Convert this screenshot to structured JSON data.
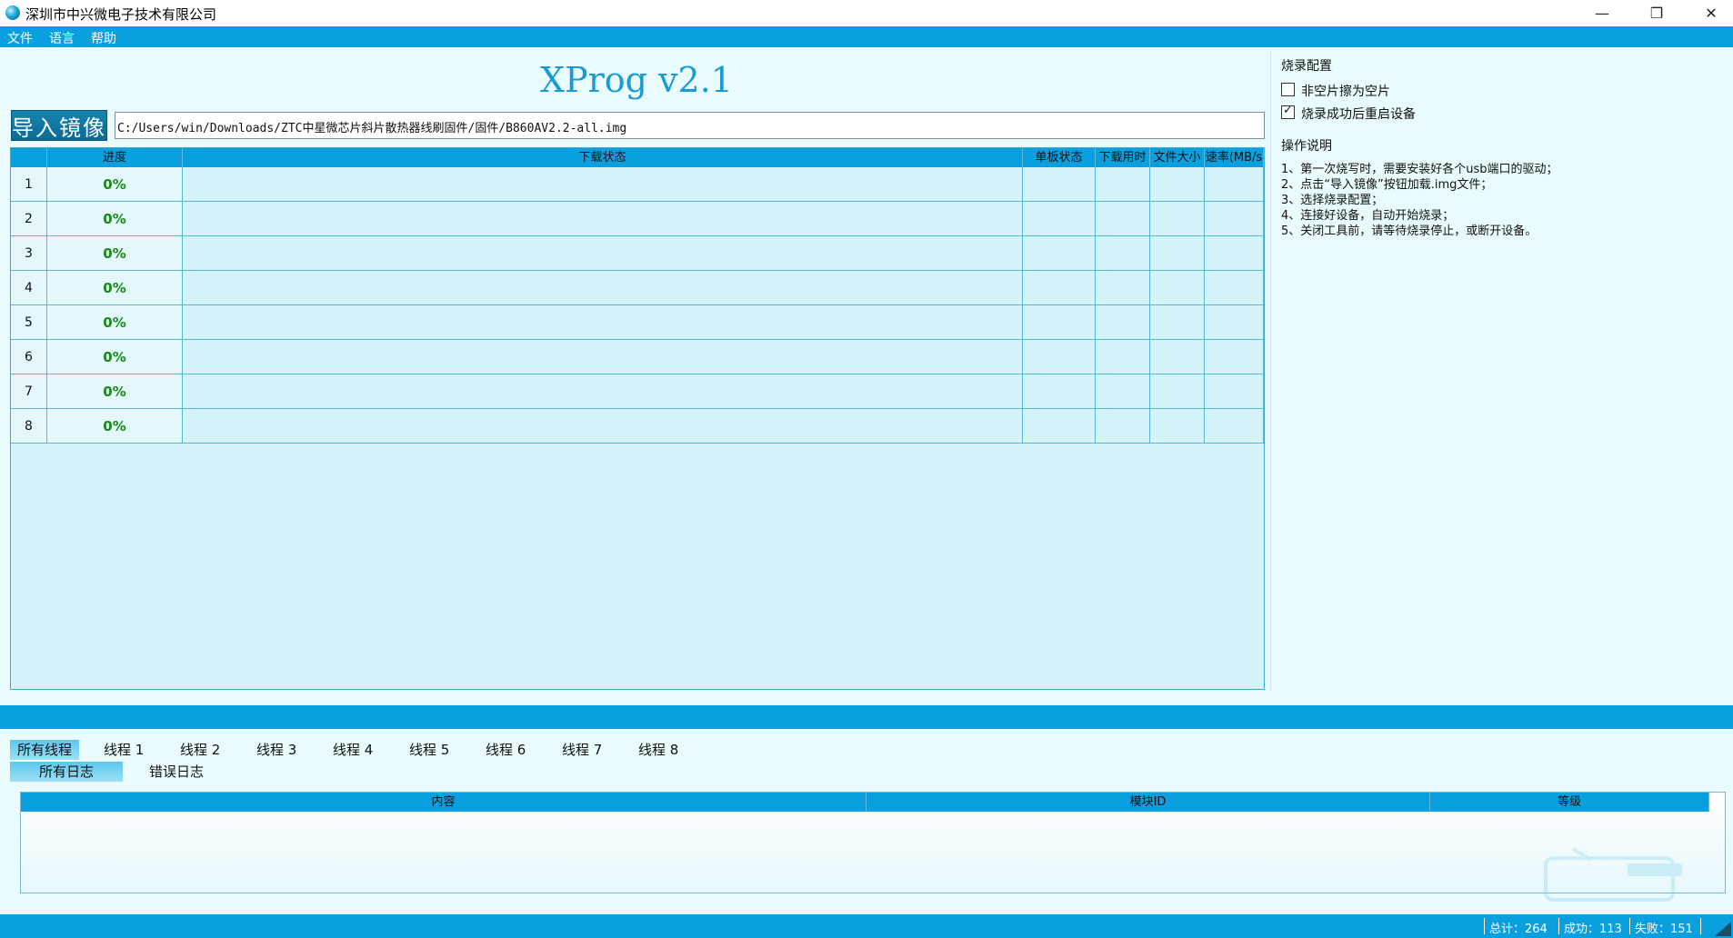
{
  "window": {
    "title": "深圳市中兴微电子技术有限公司",
    "minimize_glyph": "—",
    "restore_glyph": "❐",
    "close_glyph": "✕"
  },
  "menu": [
    "文件",
    "语言",
    "帮助"
  ],
  "app_title": "XProg v2.1",
  "import": {
    "button_label": "导入镜像",
    "path": "C:/Users/win/Downloads/ZTC中星微芯片斜片散热器线刷固件/固件/B860AV2.2-all.img"
  },
  "grid": {
    "headers": [
      "",
      "进度",
      "下载状态",
      "单板状态",
      "下载用时",
      "文件大小",
      "速率(MB/s"
    ],
    "rows": [
      {
        "num": "1",
        "progress": "0%"
      },
      {
        "num": "2",
        "progress": "0%"
      },
      {
        "num": "3",
        "progress": "0%"
      },
      {
        "num": "4",
        "progress": "0%"
      },
      {
        "num": "5",
        "progress": "0%"
      },
      {
        "num": "6",
        "progress": "0%"
      },
      {
        "num": "7",
        "progress": "0%"
      },
      {
        "num": "8",
        "progress": "0%"
      }
    ]
  },
  "config": {
    "label": "烧录配置",
    "options": [
      {
        "label": "非空片擦为空片",
        "checked": false
      },
      {
        "label": "烧录成功后重启设备",
        "checked": true
      }
    ]
  },
  "instructions": {
    "label": "操作说明",
    "lines": [
      "1、第一次烧写时，需要安装好各个usb端口的驱动；",
      "2、点击“导入镜像”按钮加载.img文件；",
      "3、选择烧录配置；",
      "4、连接好设备，自动开始烧录；",
      "5、关闭工具前，请等待烧录停止，或断开设备。"
    ]
  },
  "thread_tabs": [
    "所有线程",
    "线程 1",
    "线程 2",
    "线程 3",
    "线程 4",
    "线程 5",
    "线程 6",
    "线程 7",
    "线程 8"
  ],
  "log_tabs": [
    "所有日志",
    "错误日志"
  ],
  "log_headers": [
    "内容",
    "模块ID",
    "等级"
  ],
  "status": {
    "total": "总计：264",
    "success": "成功：113",
    "fail": "失败：151"
  },
  "colors": {
    "accent": "#0aa0df",
    "progress_text": "#1a8a1a",
    "title": "#1a9cd0"
  }
}
